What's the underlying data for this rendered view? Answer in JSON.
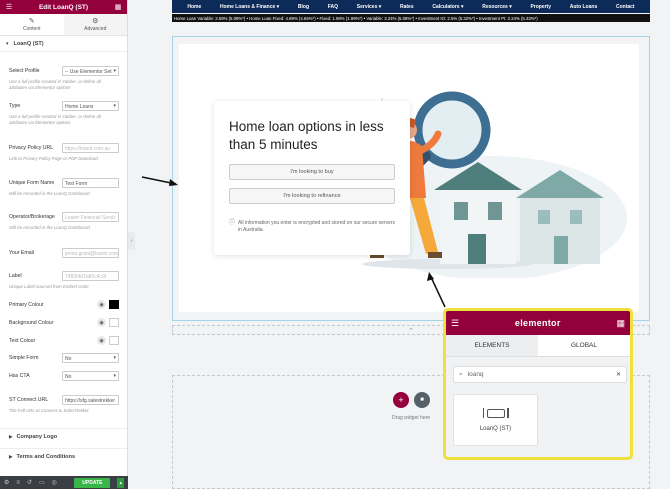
{
  "panel": {
    "title": "Edit LoanQ (ST)",
    "tabs": [
      {
        "label": "Content",
        "icon": "pencil-icon"
      },
      {
        "label": "Advanced",
        "icon": "gear-icon"
      }
    ],
    "section_title": "LoanQ (ST)",
    "controls": {
      "select_profile": {
        "label": "Select Profile",
        "value": "-- Use Elementor Set",
        "help": "Use a full profile created in Yabber, or define all attributes via Elementor options"
      },
      "type": {
        "label": "Type",
        "value": "Home Loans",
        "help": "Use a full profile created in Yabber, or define all attributes via Elementor options"
      },
      "privacy_url": {
        "label": "Privacy Policy URL",
        "value": "https://loantr.com.au",
        "help": "Link to Privacy Policy Page or PDF Download"
      },
      "form_name": {
        "label": "Unique Form Name",
        "value": "Test Form",
        "help": "Will be recorded in the LoanQ Dashboard"
      },
      "operator": {
        "label": "Operator/Brokerage",
        "value": "Loantr Financial Servic",
        "help": "Will be recorded in the LoanQ Dashboard"
      },
      "email": {
        "label": "Your Email",
        "value": "jenna.grant@loantr.com"
      },
      "label": {
        "label": "Label",
        "value": "7482f4d1b85c4c9f",
        "help": "Unique Label sourced from Embed Code"
      },
      "primary_colour": {
        "label": "Primary Colour"
      },
      "background_colour": {
        "label": "Background Colour"
      },
      "text_colour": {
        "label": "Text Colour"
      },
      "simple_form": {
        "label": "Simple Form",
        "value": "No"
      },
      "has_cta": {
        "label": "Has CTA",
        "value": "No"
      },
      "st_connect": {
        "label": "ST Connect URL",
        "value": "https://sfg.salestrekker",
        "help": "The Full URL to Connect to SalesTrekker"
      }
    },
    "collapsed_sections": [
      "Company Logo",
      "Terms and Conditions"
    ],
    "footer": {
      "update_label": "UPDATE"
    }
  },
  "nav": {
    "items": [
      "Home",
      "Home Loans & Finance ▾",
      "Blog",
      "FAQ",
      "Services ▾",
      "Rates",
      "Calculators ▾",
      "Resources ▾",
      "Property",
      "Auto Loans",
      "Contact"
    ],
    "ticker": "Home Loan Variable: 3.59% (5.08%*) • Home Loan Fixed: 4.89% (4.65%*) • Fixed: 1.99% (1.99%*) • Variable: 3.24% (5.08%*) • Investment IO: 2.5% (5.32%*) • Investment PI: 2.24% (5.33%*)"
  },
  "hero": {
    "title": "Home loan options in less than 5 minutes",
    "button_buy": "I'm looking to buy",
    "button_refinance": "I'm looking to refinance",
    "info_text": "All information you enter is encrypted and stored on our secure servers in Australia."
  },
  "canvas": {
    "add_section_icon": "+",
    "drag_label": "Drag widget here"
  },
  "popup": {
    "brand": "elementor",
    "tabs": [
      "ELEMENTS",
      "GLOBAL"
    ],
    "search_value": "loanq",
    "widget_label": "LoanQ (ST)"
  },
  "colors": {
    "elementor_primary": "#93003c",
    "nav_bg": "#0d2b59",
    "highlight": "#f0e13a",
    "update_green": "#39b54a"
  }
}
